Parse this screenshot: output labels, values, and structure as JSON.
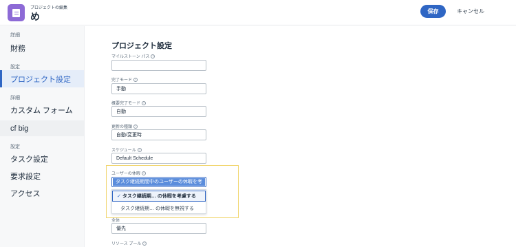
{
  "header": {
    "subtitle": "プロジェクトの編集",
    "title": "め",
    "save_label": "保存",
    "cancel_label": "キャンセル"
  },
  "sidebar": {
    "groups": [
      {
        "category": "詳細",
        "items": [
          "財務"
        ]
      },
      {
        "category": "設定",
        "items": [
          "プロジェクト設定"
        ]
      },
      {
        "category": "詳細",
        "items": [
          "カスタム フォーム",
          "cf big"
        ]
      },
      {
        "category": "設定",
        "items": [
          "タスク設定",
          "要求設定",
          "アクセス"
        ]
      }
    ],
    "active_item": "プロジェクト設定"
  },
  "main": {
    "title": "プロジェクト設定",
    "fields": [
      {
        "label": "マイルストーン パス",
        "value": ""
      },
      {
        "label": "完了モード",
        "value": "手動"
      },
      {
        "label": "概要完了モード",
        "value": "自動"
      },
      {
        "label": "更新の種類",
        "value": "自動/変更時"
      },
      {
        "label": "スケジュール",
        "value": "Default Schedule"
      },
      {
        "label": "ユーザーの休暇",
        "value": "タスク継続期間中のユーザーの休暇を考"
      },
      {
        "label": "全体",
        "value": "優先"
      },
      {
        "label": "リソース プール",
        "value": ""
      }
    ],
    "dropdown_options": [
      {
        "label": "タスク継続期… の休暇を考慮する",
        "selected": true
      },
      {
        "label": "タスク継続期… の休暇を無視する",
        "selected": false
      }
    ]
  },
  "colors": {
    "accent": "#2f66c4",
    "app_icon": "#8d6ad6",
    "highlight_border": "#f1d56c"
  },
  "icons": {
    "app": "document-icon",
    "help": "help-icon",
    "check": "check-icon"
  }
}
